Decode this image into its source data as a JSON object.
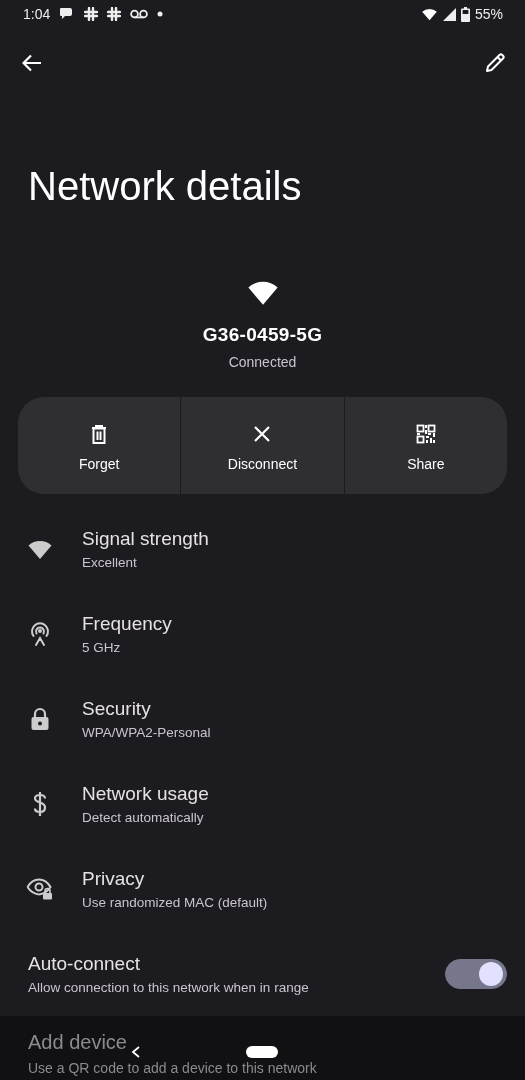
{
  "status_bar": {
    "time": "1:04",
    "battery": "55%"
  },
  "title": "Network details",
  "network": {
    "ssid": "G36-0459-5G",
    "status": "Connected"
  },
  "actions": [
    {
      "kind": "forget",
      "label": "Forget"
    },
    {
      "kind": "disconnect",
      "label": "Disconnect"
    },
    {
      "kind": "share",
      "label": "Share"
    }
  ],
  "details": [
    {
      "kind": "signal",
      "title": "Signal strength",
      "value": "Excellent"
    },
    {
      "kind": "frequency",
      "title": "Frequency",
      "value": "5 GHz"
    },
    {
      "kind": "security",
      "title": "Security",
      "value": "WPA/WPA2-Personal"
    },
    {
      "kind": "usage",
      "title": "Network usage",
      "value": "Detect automatically"
    },
    {
      "kind": "privacy",
      "title": "Privacy",
      "value": "Use randomized MAC (default)"
    }
  ],
  "auto_connect": {
    "title": "Auto-connect",
    "subtitle": "Allow connection to this network when in range",
    "on": true
  },
  "add_device": {
    "title": "Add device",
    "subtitle": "Use a QR code to add a device to this network"
  }
}
